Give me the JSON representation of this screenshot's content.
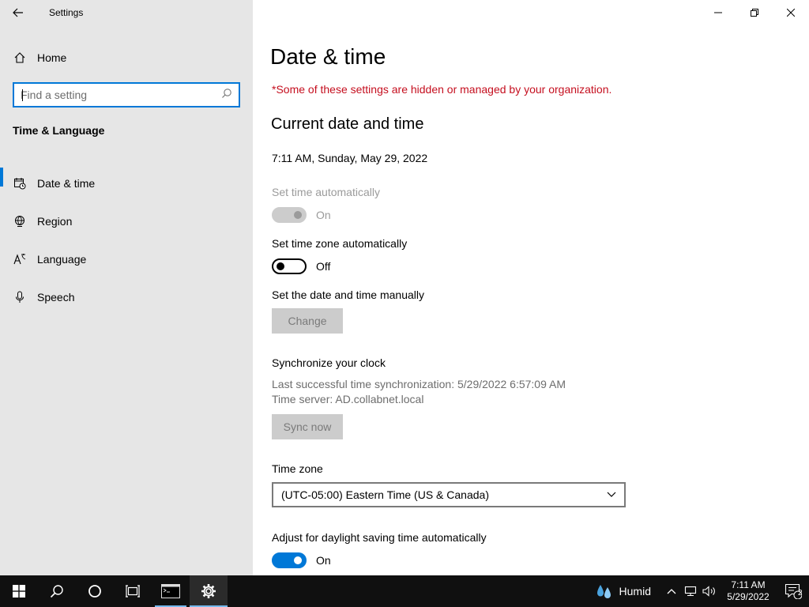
{
  "window": {
    "title": "Settings"
  },
  "sidebar": {
    "home_label": "Home",
    "search_placeholder": "Find a setting",
    "section_title": "Time & Language",
    "items": [
      {
        "label": "Date & time",
        "icon": "calendar-clock-icon",
        "active": true
      },
      {
        "label": "Region",
        "icon": "globe-icon",
        "active": false
      },
      {
        "label": "Language",
        "icon": "language-icon",
        "active": false
      },
      {
        "label": "Speech",
        "icon": "microphone-icon",
        "active": false
      }
    ]
  },
  "main": {
    "page_title": "Date & time",
    "managed_notice": "*Some of these settings are hidden or managed by your organization.",
    "current_heading": "Current date and time",
    "current_value": "7:11 AM, Sunday, May 29, 2022",
    "set_time_auto": {
      "label": "Set time automatically",
      "state": "On"
    },
    "set_tz_auto": {
      "label": "Set time zone automatically",
      "state": "Off"
    },
    "manual": {
      "label": "Set the date and time manually",
      "button": "Change"
    },
    "sync": {
      "heading": "Synchronize your clock",
      "last_sync": "Last successful time synchronization: 5/29/2022 6:57:09 AM",
      "server": "Time server: AD.collabnet.local",
      "button": "Sync now"
    },
    "timezone": {
      "label": "Time zone",
      "value": "(UTC-05:00) Eastern Time (US & Canada)"
    },
    "dst": {
      "label": "Adjust for daylight saving time automatically",
      "state": "On"
    }
  },
  "taskbar": {
    "weather": "Humid",
    "time": "7:11 AM",
    "date": "5/29/2022",
    "notification_count": "2"
  },
  "colors": {
    "accent": "#0078d7",
    "warning": "#c50f1f",
    "sidebar_bg": "#e6e6e6",
    "taskbar_bg": "#101010"
  }
}
